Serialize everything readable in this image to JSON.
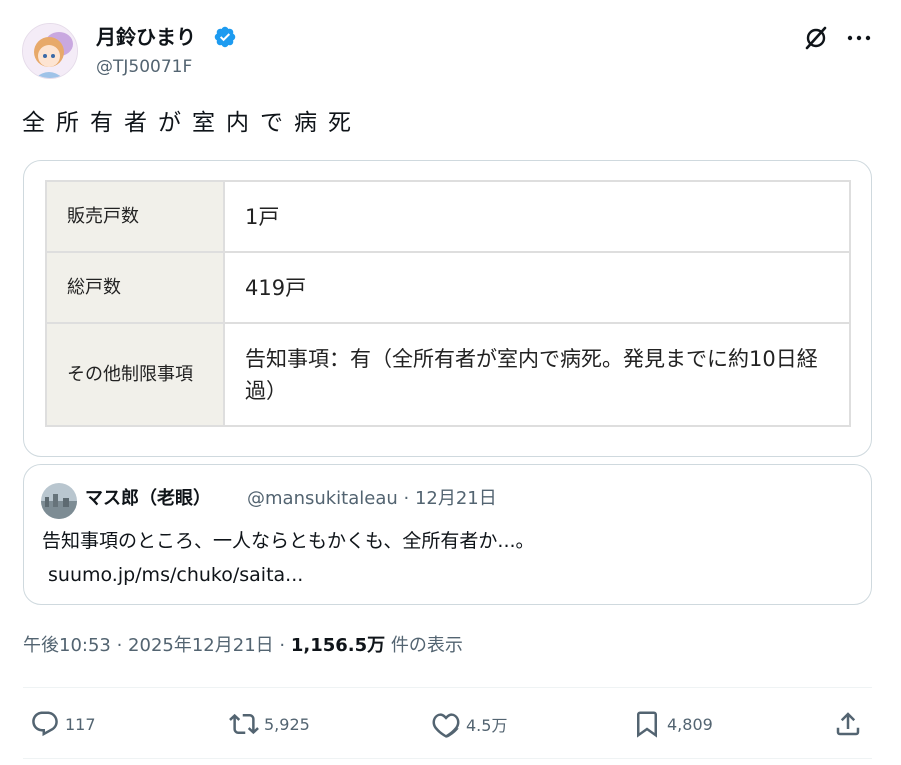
{
  "author": {
    "display_name": "月鈴ひまり",
    "handle": "@TJ50071F",
    "verified_icon": "verified-badge-icon",
    "verified_color": "#1d9bf0"
  },
  "tweet": {
    "text": "全所有者が室内で病死"
  },
  "table": {
    "rows": [
      {
        "label": "販売戸数",
        "value": "1戸"
      },
      {
        "label": "総戸数",
        "value": "419戸"
      },
      {
        "label": "その他制限事項",
        "value": "告知事項：有（全所有者が室内で病死。発見までに約10日経過）"
      }
    ]
  },
  "quote": {
    "display_name": "マス郎（老眼）",
    "handle_date": "@mansukitaleau · 12月21日",
    "text": "告知事項のところ、一人ならともかくも、全所有者か...。",
    "link": "suumo.jp/ms/chuko/saita..."
  },
  "meta": {
    "time_date": "午後10:53 · 2025年12月21日 · ",
    "views": "1,156.5万",
    "views_label": " 件の表示"
  },
  "actions": {
    "replies": "117",
    "retweets": "5,925",
    "likes": "4.5万",
    "bookmarks": "4,809"
  },
  "colors": {
    "text_primary": "#0f1419",
    "text_secondary": "#536471",
    "border": "#cfd9de",
    "table_header_bg": "#f1f0ea"
  }
}
